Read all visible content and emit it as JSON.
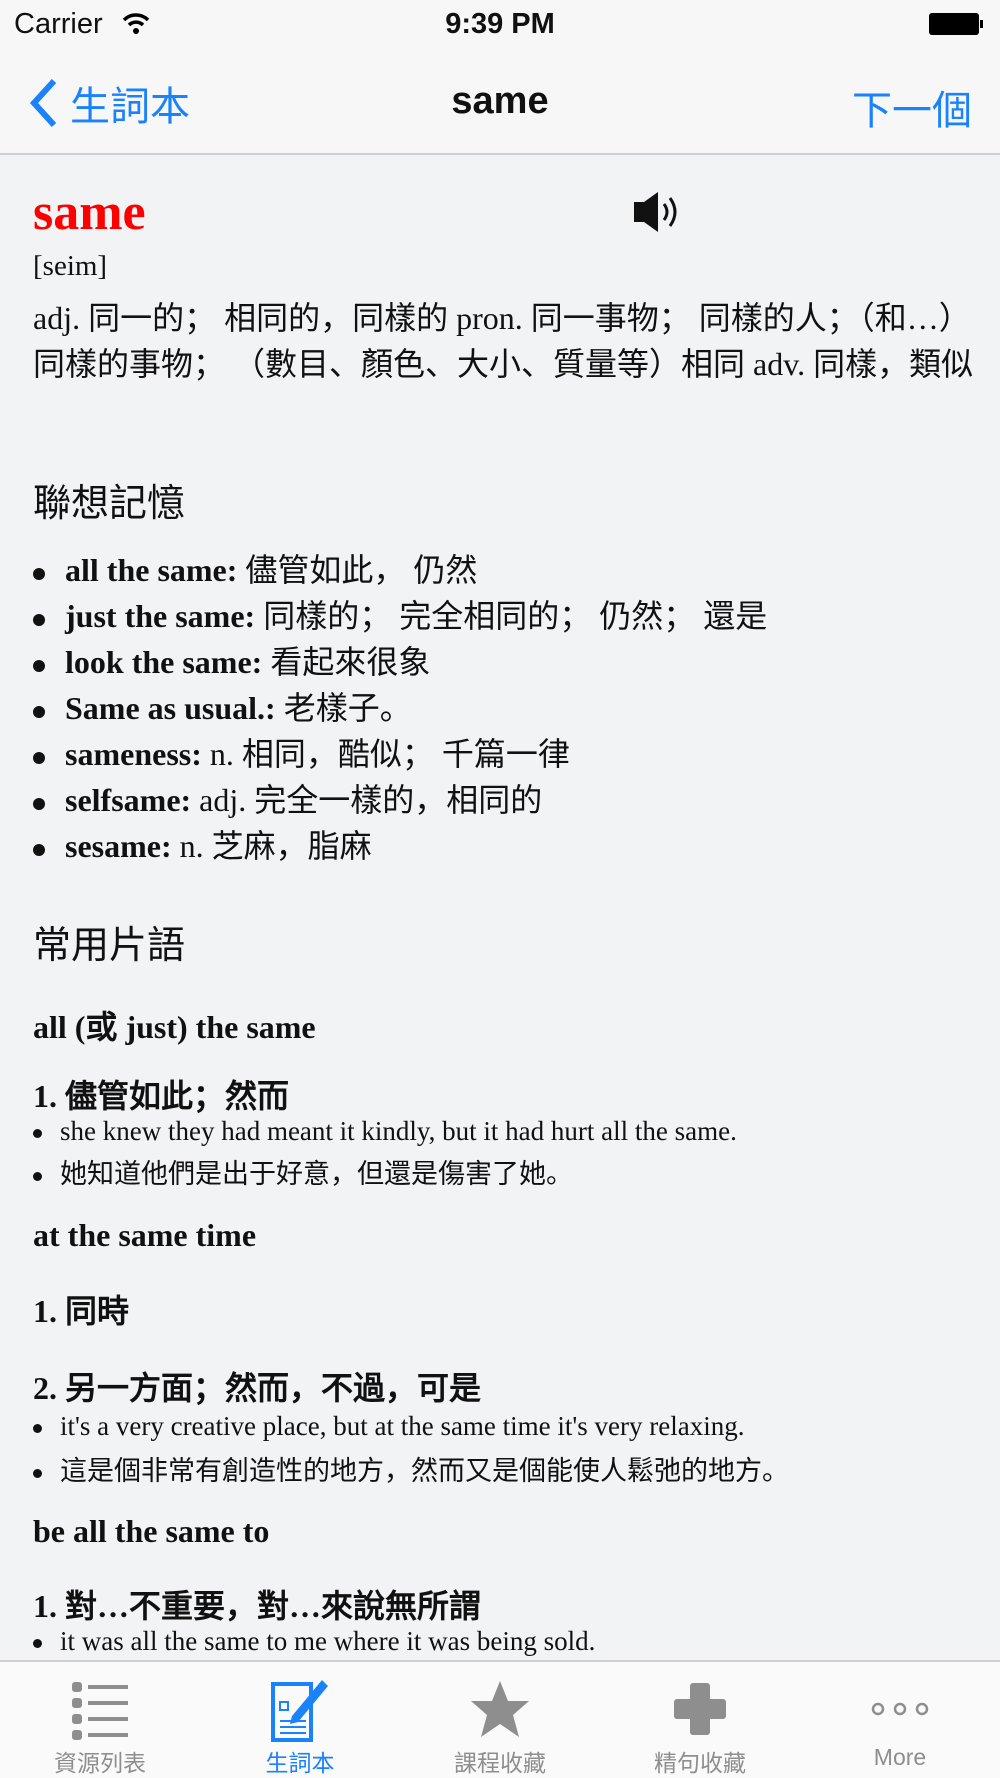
{
  "status": {
    "carrier": "Carrier",
    "time": "9:39 PM"
  },
  "nav": {
    "back_label": "生詞本",
    "title": "same",
    "next_label": "下一個"
  },
  "entry": {
    "word": "same",
    "word_color": "#ff0000",
    "phonetic": "[seim]",
    "definition": "adj. 同一的； 相同的，同樣的 pron. 同一事物； 同樣的人；（和…）同樣的事物； （數目、顏色、大小、質量等）相同 adv. 同樣，類似",
    "assoc_heading": "聯想記憶",
    "assoc": [
      {
        "term": "all the same:",
        "text": " 儘管如此， 仍然"
      },
      {
        "term": "just the same:",
        "text": " 同樣的； 完全相同的； 仍然； 還是"
      },
      {
        "term": "look the same:",
        "text": " 看起來很象"
      },
      {
        "term": "Same as usual.:",
        "text": " 老樣子。"
      },
      {
        "term": "sameness:",
        "text": " n. 相同，酷似； 千篇一律"
      },
      {
        "term": "selfsame:",
        "text": " adj. 完全一樣的，相同的"
      },
      {
        "term": "sesame:",
        "text": " n. 芝麻，脂麻"
      }
    ],
    "phrase_heading": "常用片語",
    "phrases": [
      {
        "phrase": "all (或 just) the same",
        "senses": [
          {
            "meaning": "1. 儘管如此；然而",
            "examples": [
              "she knew they had meant it kindly, but it had hurt all the same.",
              "她知道他們是出于好意，但還是傷害了她。"
            ]
          }
        ]
      },
      {
        "phrase": "at the same time",
        "senses": [
          {
            "meaning": "1. 同時",
            "examples": []
          },
          {
            "meaning": "2. 另一方面；然而，不過，可是",
            "examples": [
              "it's a very creative place, but at the same time it's very relaxing.",
              "這是個非常有創造性的地方，然而又是個能使人鬆弛的地方。"
            ]
          }
        ]
      },
      {
        "phrase": "be all the same to",
        "senses": [
          {
            "meaning": "1. 對…不重要，對…來說無所謂",
            "examples": [
              "it was all the same to me where it was being sold."
            ]
          }
        ]
      }
    ]
  },
  "tabs": [
    {
      "label": "資源列表",
      "icon": "list-icon"
    },
    {
      "label": "生詞本",
      "icon": "notebook-pencil-icon",
      "active": true
    },
    {
      "label": "課程收藏",
      "icon": "star-icon"
    },
    {
      "label": "精句收藏",
      "icon": "plus-icon"
    },
    {
      "label": "More",
      "icon": "more-icon"
    }
  ],
  "colors": {
    "accent": "#1a82fb",
    "inactive_tab": "#8e8e8e"
  }
}
